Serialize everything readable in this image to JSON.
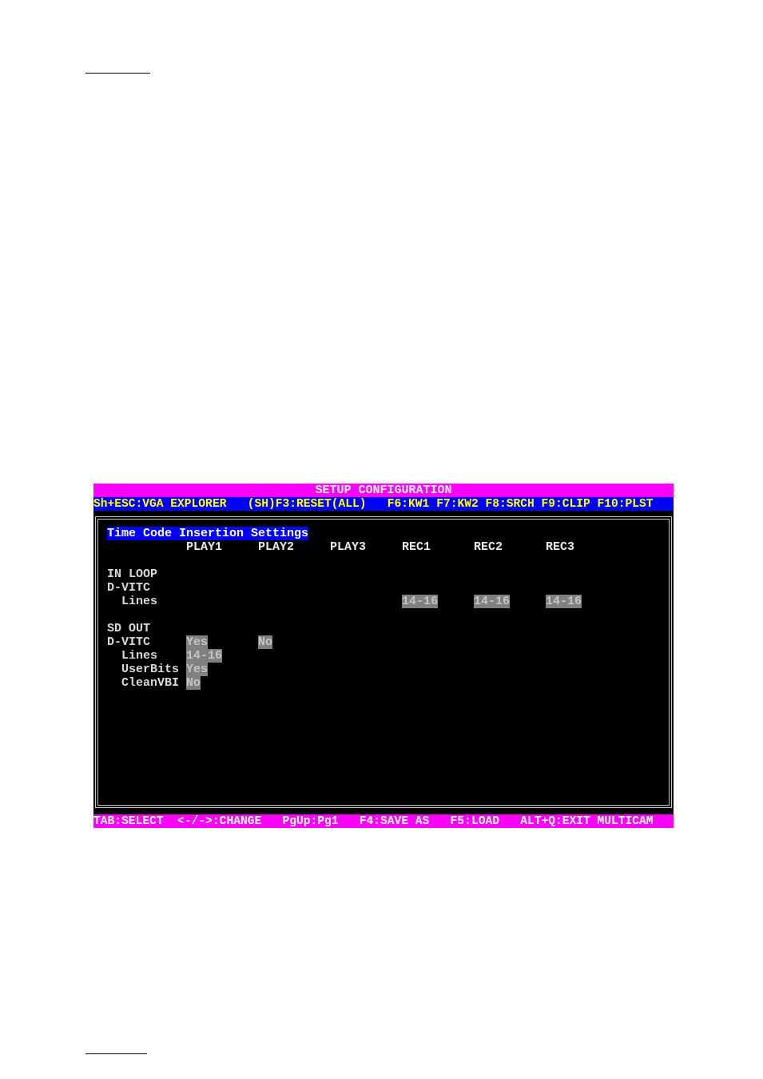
{
  "screen": {
    "title": "SETUP CONFIGURATION",
    "function_keys": [
      "Sh+ESC:VGA EXPLORER",
      "(SH)F3:RESET(ALL)",
      "F6:KW1",
      "F7:KW2",
      "F8:SRCH",
      "F9:CLIP",
      "F10:PLST"
    ],
    "panel": {
      "title": "Time Code Insertion Settings",
      "columns": [
        "PLAY1",
        "PLAY2",
        "PLAY3",
        "REC1",
        "REC2",
        "REC3"
      ],
      "sections": [
        {
          "heading": "IN LOOP",
          "items": [
            {
              "label": "D-VITC",
              "children": [
                {
                  "label": "Lines",
                  "values": {
                    "column_4": "14-16",
                    "column_5": "14-16",
                    "column_6": "14-16"
                  }
                }
              ]
            }
          ]
        },
        {
          "heading": "SD OUT",
          "items": [
            {
              "label": "D-VITC",
              "values": {
                "column_1": "Yes",
                "column_2": "No"
              },
              "children": [
                {
                  "label": "Lines",
                  "values": {
                    "column_1": "14-16"
                  }
                },
                {
                  "label": "UserBits",
                  "values": {
                    "column_1": "Yes"
                  }
                },
                {
                  "label": "CleanVBI",
                  "values": {
                    "column_1": "No"
                  }
                }
              ]
            }
          ]
        }
      ]
    },
    "key_hints": [
      "TAB:SELECT",
      "<-/->:CHANGE",
      "PgUp:Pg1",
      "F4:SAVE AS",
      "F5:LOAD",
      "ALT+Q:EXIT MULTICAM"
    ]
  }
}
